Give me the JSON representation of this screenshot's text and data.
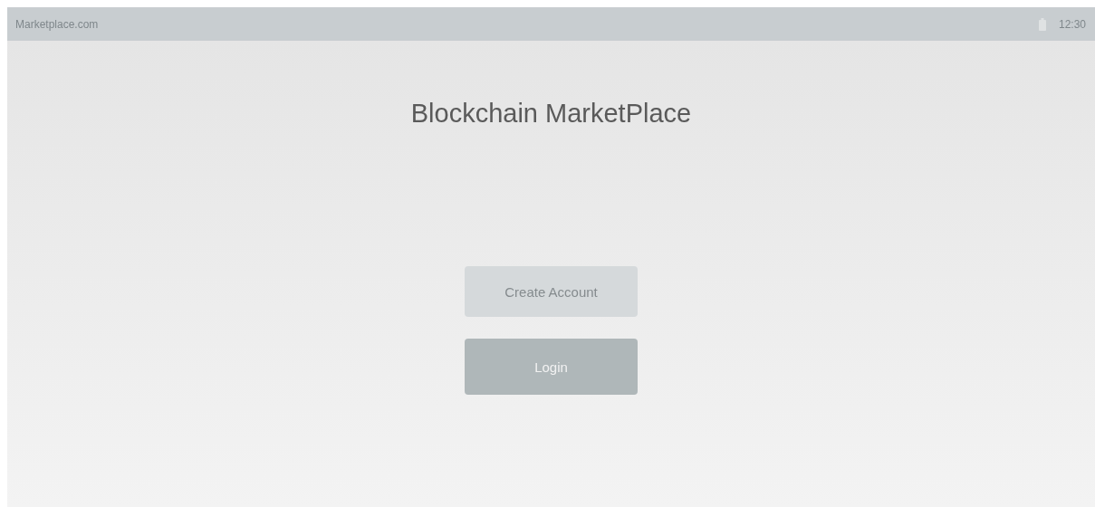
{
  "status_bar": {
    "site": "Marketplace.com",
    "time": "12:30"
  },
  "title": "Blockchain MarketPlace",
  "buttons": [
    {
      "label": "Create Account",
      "kind": "secondary"
    },
    {
      "label": "Login",
      "kind": "primary"
    }
  ]
}
